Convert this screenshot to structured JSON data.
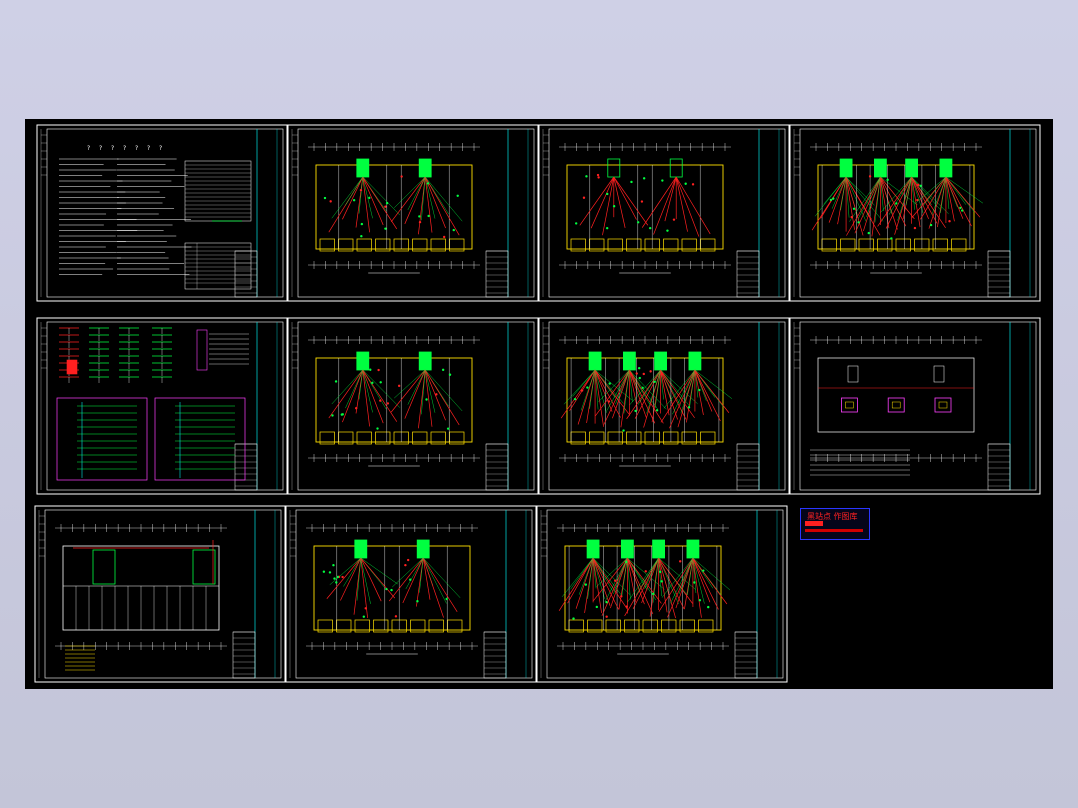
{
  "viewer": {
    "background": "#c9cadf",
    "canvas_color": "#000000"
  },
  "sheets": [
    {
      "id": 1,
      "kind": "notes"
    },
    {
      "id": 2,
      "kind": "plan-outline"
    },
    {
      "id": 3,
      "kind": "plan-grounding"
    },
    {
      "id": 4,
      "kind": "plan-dense"
    },
    {
      "id": 5,
      "kind": "riser-system"
    },
    {
      "id": 6,
      "kind": "plan-outline"
    },
    {
      "id": 7,
      "kind": "plan-dense"
    },
    {
      "id": 8,
      "kind": "roof-plan"
    },
    {
      "id": 9,
      "kind": "basement-plan"
    },
    {
      "id": 10,
      "kind": "plan-outline"
    },
    {
      "id": 11,
      "kind": "plan-dense"
    }
  ],
  "stamp": {
    "title": "黑站点 作图库"
  },
  "colors": {
    "frame": "#ffffff",
    "titleblock": "#00e5e5",
    "wiring": "#ff2020",
    "fixtures": "#00ff40",
    "walls": "#ffe000",
    "magenta": "#ff40ff",
    "stamp_border": "#2a36ff"
  }
}
